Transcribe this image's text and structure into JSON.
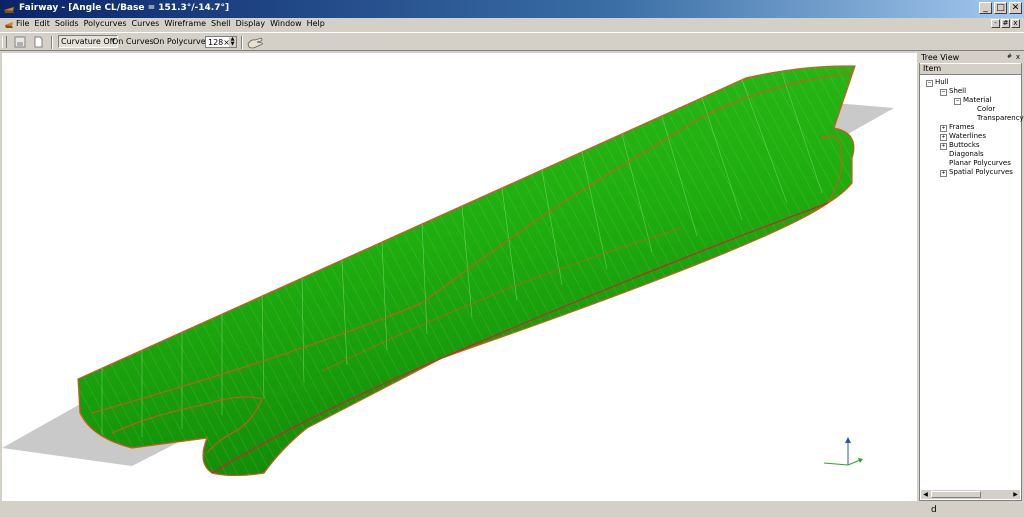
{
  "window": {
    "title": "Fairway - [Angle CL/Base = 151.3°/-14.7°]",
    "controls": [
      "_",
      "□",
      "✕"
    ]
  },
  "menu": {
    "items": [
      "File",
      "Edit",
      "Solids",
      "Polycurves",
      "Curves",
      "Wireframe",
      "Shell",
      "Display",
      "Window",
      "Help"
    ],
    "mdi_controls": [
      "-",
      "#",
      "x"
    ]
  },
  "toolbar": {
    "curvature_off": "Curvature Off",
    "on_curves": "On Curves",
    "on_polycurves": "On Polycurves",
    "density_value": "128×"
  },
  "tree_view": {
    "title": "Tree View",
    "pin": "#",
    "close": "x",
    "column_header": "Item",
    "nodes": {
      "hull": "Hull",
      "shell": "Shell",
      "material": "Material",
      "color": "Color",
      "transparency": "Transparency",
      "frames": "Frames",
      "waterlines": "Waterlines",
      "buttocks": "Buttocks",
      "diagonals": "Diagonals",
      "planar_polycurves": "Planar Polycurves",
      "spatial_polycurves": "Spatial Polycurves"
    }
  },
  "status": {
    "text": "d"
  },
  "colors": {
    "hull": "#1fae0f",
    "hull_dark": "#137a0a",
    "outline": "#e05020",
    "plane": "#c9c9c9",
    "titlebar": "#0a246a"
  }
}
